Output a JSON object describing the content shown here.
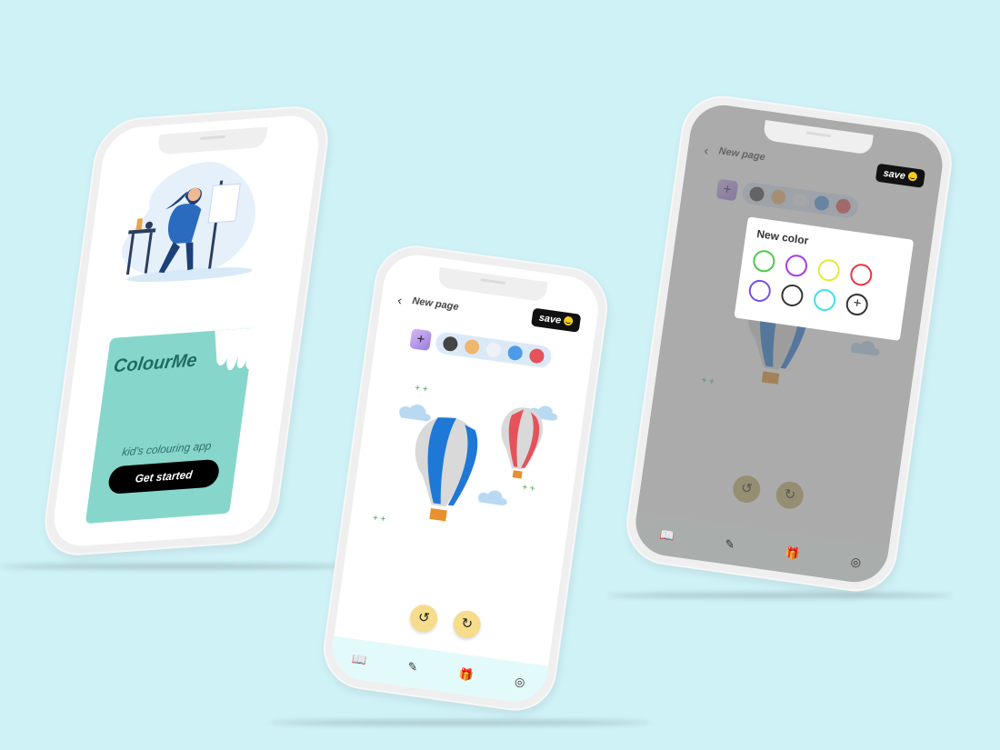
{
  "phone1": {
    "brand": "ColourMe",
    "tagline": "kid’s colouring app",
    "cta": "Get started"
  },
  "editor": {
    "title": "New page",
    "save_label": "save",
    "back_icon": "chevron-left-icon",
    "add_color_icon": "plus-icon",
    "swatches": [
      "#444444",
      "#efb66e",
      "#eef1f5",
      "#4c9be6",
      "#e5525a"
    ],
    "undo_icon": "undo-icon",
    "redo_icon": "redo-icon",
    "nav": [
      {
        "icon": "book-icon"
      },
      {
        "icon": "pencil-icon"
      },
      {
        "icon": "gift-icon"
      },
      {
        "icon": "aperture-icon"
      }
    ]
  },
  "dialog": {
    "title": "New color",
    "rings": [
      "#4cc94f",
      "#a73ce6",
      "#e7ea34",
      "#e8363e",
      "#7a4fe3",
      "#333333",
      "#3fe0e3"
    ],
    "add_icon": "plus-circle-icon"
  },
  "colors": {
    "background": "#cff2f7",
    "accent_mint": "#87d6cb",
    "button_yellow": "#f6dc8b",
    "nav_tint": "#e3fafb"
  }
}
